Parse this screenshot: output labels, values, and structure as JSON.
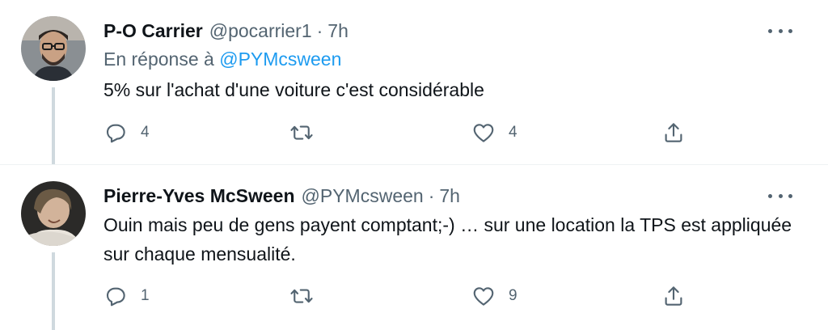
{
  "tweets": [
    {
      "name": "P-O Carrier",
      "handle": "@pocarrier1",
      "separator": "·",
      "time": "7h",
      "reply_prefix": "En réponse à",
      "reply_mention": "@PYMcsween",
      "text": "5% sur l'achat d'une voiture c'est considérable",
      "replies": "4",
      "retweets": "",
      "likes": "4"
    },
    {
      "name": "Pierre-Yves McSween",
      "handle": "@PYMcsween",
      "separator": "·",
      "time": "7h",
      "text": "Ouin mais peu de gens payent comptant;-) … sur une location la TPS est appliquée sur chaque mensualité.",
      "replies": "1",
      "retweets": "",
      "likes": "9"
    }
  ],
  "icons": {
    "reply": "speech-bubble",
    "retweet": "retweet-arrows",
    "like": "heart-outline",
    "share": "share-arrow-up",
    "more": "three-dots"
  },
  "colors": {
    "text": "#0f1419",
    "secondary": "#536471",
    "link": "#1d9bf0",
    "thread_line": "#cfd9de"
  }
}
